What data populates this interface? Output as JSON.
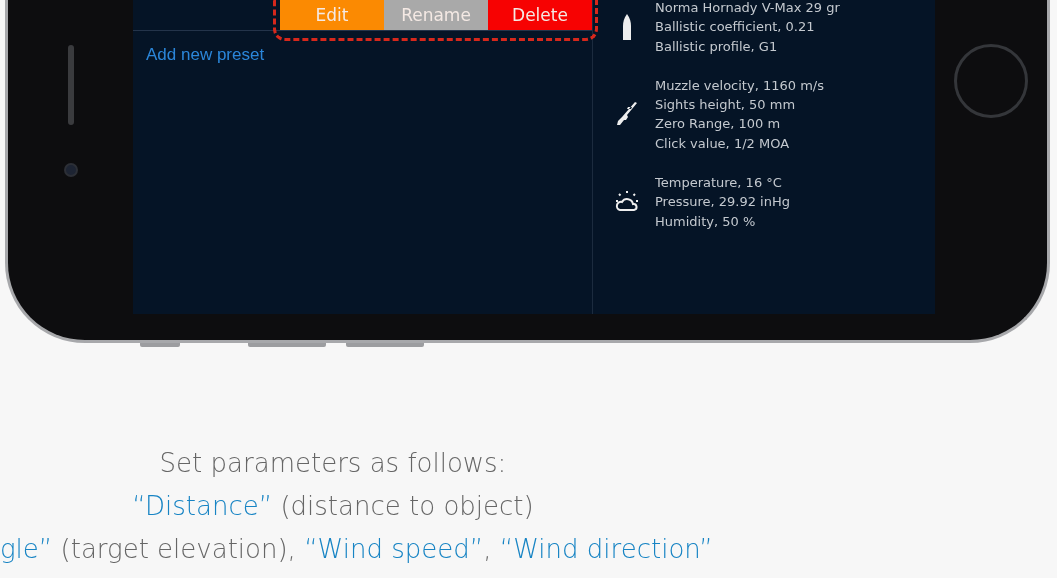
{
  "preset_actions": [
    {
      "label": "Edit",
      "kind": "edit"
    },
    {
      "label": "Rename",
      "kind": "rename"
    },
    {
      "label": "Delete",
      "kind": "delete"
    }
  ],
  "add_preset_link": "Add new preset",
  "details": [
    {
      "kind": "ammo",
      "lines": [
        "Norma Hornady V-Max 29 gr",
        "Ballistic coefficient, 0.21",
        "Ballistic profile, G1"
      ]
    },
    {
      "kind": "rifle",
      "lines": [
        "Muzzle velocity, 1160 m/s",
        "Sights height, 50 mm",
        "Zero Range, 100 m",
        "Click value, 1/2 MOA"
      ]
    },
    {
      "kind": "weather",
      "lines": [
        "Temperature, 16 °C",
        "Pressure, 29.92 inHg",
        "Humidity, 50 %"
      ]
    }
  ],
  "instructions": [
    {
      "segments": [
        {
          "text": "Set parameters as follows:",
          "kind": "plain"
        }
      ]
    },
    {
      "segments": [
        {
          "text": "“Distance”",
          "kind": "term"
        },
        {
          "text": " (distance to object)",
          "kind": "plain"
        }
      ]
    },
    {
      "segments": [
        {
          "text": "gle”",
          "kind": "term"
        },
        {
          "text": " (target elevation), ",
          "kind": "plain"
        },
        {
          "text": "“Wind speed”",
          "kind": "term"
        },
        {
          "text": ", ",
          "kind": "plain"
        },
        {
          "text": "“Wind direction”",
          "kind": "term"
        }
      ]
    }
  ]
}
